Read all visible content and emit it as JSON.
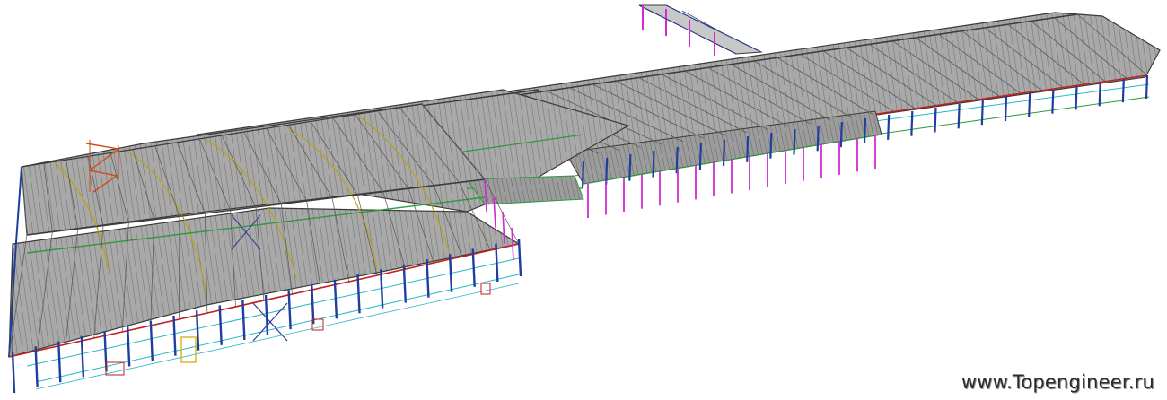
{
  "watermark": {
    "text": "www.Topengineer.ru"
  },
  "colors": {
    "background": "#ffffff",
    "roof_sheeting": "#8d8d8d",
    "roof_ridge": "#3a3a3a",
    "column": "#1f3f9e",
    "column_secondary": "#d12bd1",
    "girt": "#27b7c7",
    "eave_beam": "#c41e1e",
    "bracing": "#2c3a8c",
    "crane_beam": "#2a9a3a",
    "rafter_accent": "#b8a21a",
    "stair": "#d2491a"
  },
  "icons": [
    "3d-steel-frame-model"
  ]
}
